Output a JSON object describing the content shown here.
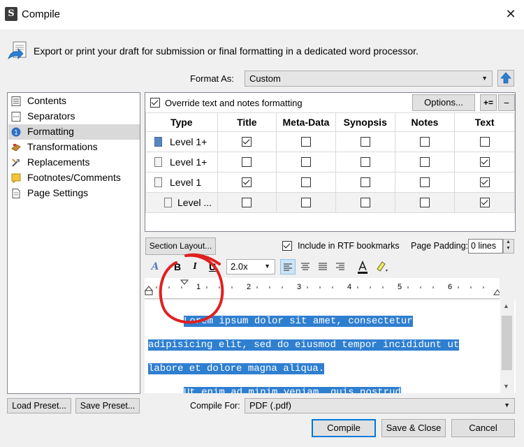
{
  "window": {
    "title": "Compile",
    "app_icon_glyph": "S"
  },
  "header": {
    "text": "Export or print your draft for submission or final formatting in a dedicated word processor."
  },
  "format_as": {
    "label": "Format As:",
    "value": "Custom"
  },
  "sidebar": {
    "items": [
      {
        "label": "Contents",
        "icon": "list-icon",
        "selected": false
      },
      {
        "label": "Separators",
        "icon": "separator-icon",
        "selected": false
      },
      {
        "label": "Formatting",
        "icon": "formatting-icon",
        "selected": true
      },
      {
        "label": "Transformations",
        "icon": "transformations-icon",
        "selected": false
      },
      {
        "label": "Replacements",
        "icon": "replacements-icon",
        "selected": false
      },
      {
        "label": "Footnotes/Comments",
        "icon": "footnotes-icon",
        "selected": false
      },
      {
        "label": "Page Settings",
        "icon": "page-icon",
        "selected": false
      }
    ]
  },
  "formatting": {
    "override_label": "Override text and notes formatting",
    "override_checked": true,
    "options_button": "Options...",
    "add_button": "+=",
    "remove_button": "−",
    "columns": [
      "Type",
      "Title",
      "Meta-Data",
      "Synopsis",
      "Notes",
      "Text"
    ],
    "rows": [
      {
        "type": "Level 1+",
        "icon": "folder",
        "title": true,
        "metadata": false,
        "synopsis": false,
        "notes": false,
        "text": false
      },
      {
        "type": "Level 1+",
        "icon": "doc",
        "title": false,
        "metadata": false,
        "synopsis": false,
        "notes": false,
        "text": true
      },
      {
        "type": "Level 1",
        "icon": "doc",
        "title": true,
        "metadata": false,
        "synopsis": false,
        "notes": false,
        "text": true
      },
      {
        "type": "Level ...",
        "icon": "doc",
        "title": false,
        "metadata": false,
        "synopsis": false,
        "notes": false,
        "text": true
      }
    ]
  },
  "section_bar": {
    "section_layout_button": "Section Layout...",
    "rtf_bookmarks_label": "Include in RTF bookmarks",
    "rtf_bookmarks_checked": true,
    "page_padding_label": "Page Padding:",
    "page_padding_value": "0 lines"
  },
  "format_toolbar": {
    "bold": "B",
    "italic": "I",
    "underline": "U",
    "line_spacing": "2.0x"
  },
  "ruler": {
    "numbers": [
      "1",
      "2",
      "3",
      "4",
      "5",
      "6"
    ]
  },
  "editor": {
    "lines": [
      "Lorem ipsum dolor sit amet, consectetur",
      "adipisicing elit, sed do eiusmod tempor incididunt ut",
      "labore et dolore magna aliqua.",
      "Ut enim ad minim veniam, quis nostrud"
    ]
  },
  "bottom": {
    "load_preset": "Load Preset...",
    "save_preset": "Save Preset...",
    "compile_for_label": "Compile For:",
    "compile_for_value": "PDF (.pdf)",
    "compile_button": "Compile",
    "save_close_button": "Save & Close",
    "cancel_button": "Cancel"
  },
  "colors": {
    "accent": "#0078d7",
    "selection": "#2f7fd0",
    "annotation": "#e02020"
  }
}
